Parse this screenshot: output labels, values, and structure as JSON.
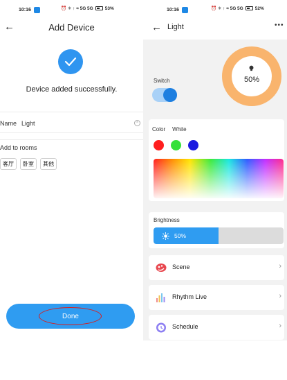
{
  "left_screen": {
    "status": {
      "time": "10:16",
      "battery": "53%",
      "signal_icons": "⏰ ✳ ↑ ≈ 5G 5G"
    },
    "title": "Add Device",
    "success_message": "Device added successfully.",
    "name_label": "Name",
    "name_value": "Light",
    "rooms_label": "Add to rooms",
    "rooms": [
      "客厅",
      "卧室",
      "其他"
    ],
    "done_label": "Done",
    "annotation_color": "#d71d1d"
  },
  "right_screen": {
    "status": {
      "time": "10:16",
      "battery": "52%",
      "signal_icons": "⏰ ✳ ↑ ≈ 5G 5G"
    },
    "title": "Light",
    "more_icon": "more-dots-icon",
    "switch_label": "Switch",
    "switch_on": true,
    "ring_percent": "50%",
    "color_tabs": [
      "Color",
      "White"
    ],
    "swatches": [
      {
        "name": "red",
        "color": "#ff1e1e"
      },
      {
        "name": "green",
        "color": "#35e03a"
      },
      {
        "name": "blue",
        "color": "#1a1ae0"
      }
    ],
    "brightness_label": "Brightness",
    "brightness_value": "50%",
    "brightness_fraction": 0.5,
    "menu": [
      {
        "label": "Scene",
        "icon": "scene-icon"
      },
      {
        "label": "Rhythm Live",
        "icon": "rhythm-icon"
      },
      {
        "label": "Schedule",
        "icon": "schedule-icon"
      }
    ]
  },
  "colors": {
    "primary_blue": "#2f9cf1",
    "ring_orange": "#f9b46d",
    "background_gray": "#f2f2f2"
  }
}
